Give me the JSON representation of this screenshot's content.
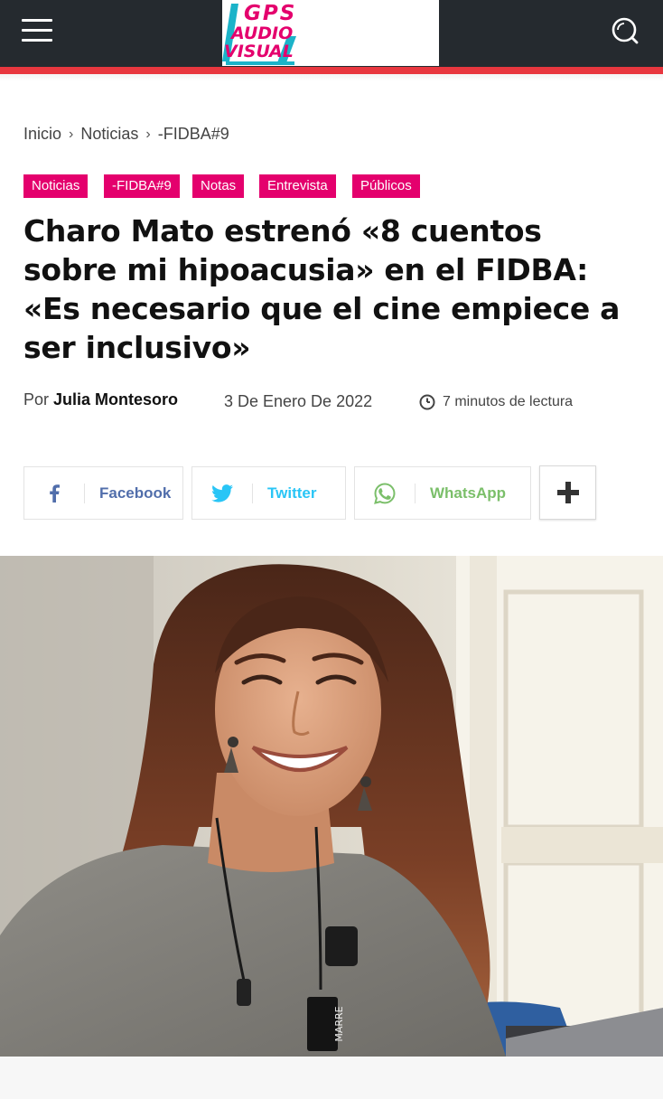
{
  "header": {
    "logo_line1": "GPS",
    "logo_line2": "AUDIO",
    "logo_line3": "VISUAL",
    "menu_icon": "hamburger-icon",
    "search_icon": "search-icon",
    "bg_color": "#252a2f",
    "accent_color": "#e8373f"
  },
  "breadcrumb": {
    "items": [
      "Inicio",
      "Noticias",
      "-FIDBA#9"
    ],
    "separator": "›"
  },
  "tags": [
    "Noticias",
    "-FIDBA#9",
    "Notas",
    "Entrevista",
    "Públicos"
  ],
  "tag_color": "#e4006d",
  "article": {
    "title": "Charo Mato estrenó «8 cuentos sobre mi hipoacusia» en el FIDBA: «Es necesario que el cine empiece a ser inclusivo»",
    "by_label": "Por",
    "author": "Julia Montesoro",
    "date": "3 De Enero De 2022",
    "read_time": "7 minutos de lectura"
  },
  "share": {
    "facebook": {
      "label": "Facebook",
      "color": "#516eab",
      "icon": "facebook-icon"
    },
    "twitter": {
      "label": "Twitter",
      "color": "#29c5f6",
      "icon": "twitter-icon"
    },
    "whatsapp": {
      "label": "WhatsApp",
      "color": "#7bbf6a",
      "icon": "whatsapp-icon"
    },
    "more_icon": "plus-icon"
  },
  "featured_image": {
    "subject": "woman-smiling-portrait",
    "mic_tag_text": "MARRE"
  }
}
